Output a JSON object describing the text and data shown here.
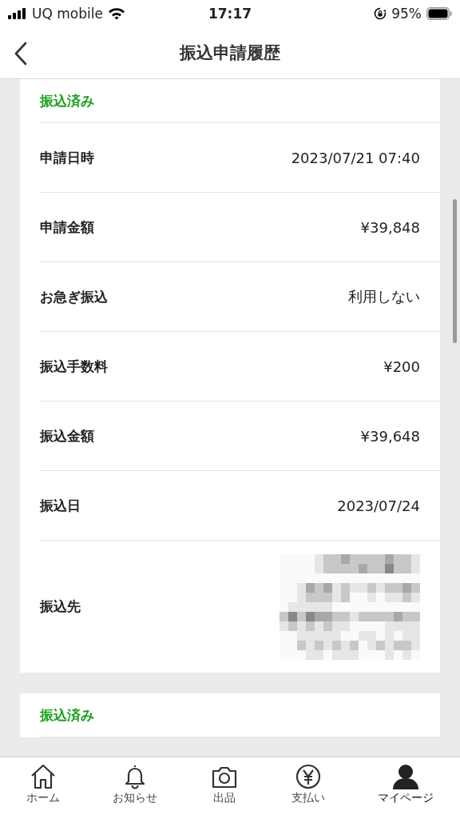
{
  "status_bar": {
    "carrier": "UQ mobile",
    "time": "17:17",
    "battery": "95%"
  },
  "nav": {
    "title": "振込申請履歴"
  },
  "records": [
    {
      "status": "振込済み",
      "rows": [
        {
          "kind": "text",
          "label": "申請日時",
          "value": "2023/07/21 07:40"
        },
        {
          "kind": "text",
          "label": "申請金額",
          "value": "¥39,848"
        },
        {
          "kind": "text",
          "label": "お急ぎ振込",
          "value": "利用しない"
        },
        {
          "kind": "text",
          "label": "振込手数料",
          "value": "¥200"
        },
        {
          "kind": "text",
          "label": "振込金額",
          "value": "¥39,648"
        },
        {
          "kind": "text",
          "label": "振込日",
          "value": "2023/07/24"
        },
        {
          "kind": "redacted",
          "label": "振込先"
        }
      ]
    },
    {
      "status": "振込済み"
    }
  ],
  "tabs": [
    {
      "label": "ホーム",
      "selected": false
    },
    {
      "label": "お知らせ",
      "selected": false
    },
    {
      "label": "出品",
      "selected": false
    },
    {
      "label": "支払い",
      "selected": false
    },
    {
      "label": "マイページ",
      "selected": true
    }
  ]
}
